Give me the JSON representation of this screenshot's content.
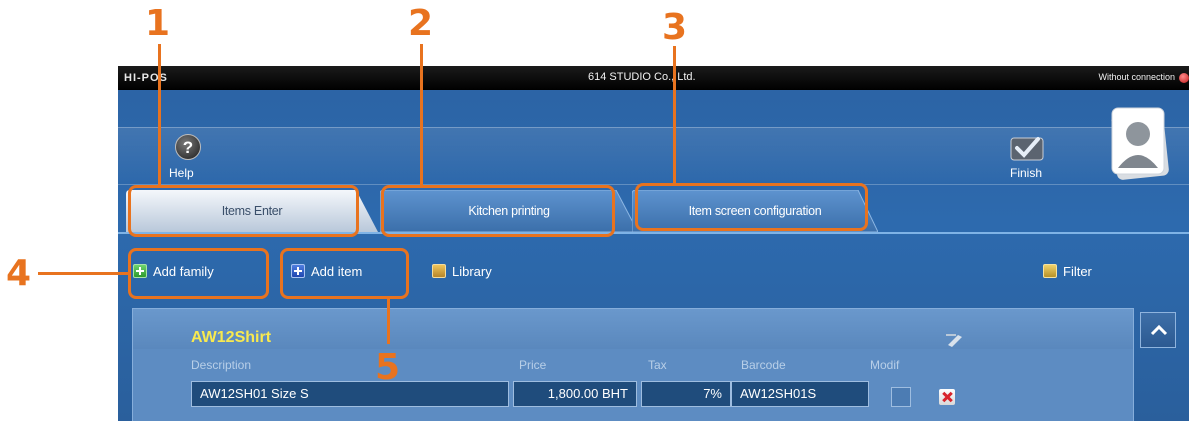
{
  "titlebar": {
    "logo": "HI-POS",
    "company": "614 STUDIO Co., Ltd.",
    "connection_status": "Without connection"
  },
  "toolbar": {
    "help_label": "Help",
    "finish_label": "Finish"
  },
  "tabs": [
    {
      "label": "Items Enter",
      "active": true
    },
    {
      "label": "Kitchen printing",
      "active": false
    },
    {
      "label": "Item screen configuration",
      "active": false
    }
  ],
  "actions": {
    "add_family": "Add family",
    "add_item": "Add item",
    "library": "Library",
    "filter": "Filter"
  },
  "family": {
    "name": "AW12Shirt",
    "columns": [
      "Description",
      "Price",
      "Tax",
      "Barcode",
      "Modif"
    ],
    "items": [
      {
        "description": "AW12SH01 Size S",
        "price": "1,800.00 BHT",
        "tax": "7%",
        "barcode": "AW12SH01S",
        "modif": false
      }
    ]
  },
  "annotations": [
    "1",
    "2",
    "3",
    "4",
    "5"
  ],
  "colors": {
    "annotation": "#e8731f",
    "family_name": "#f8e94f",
    "background": "#2d6aae"
  }
}
